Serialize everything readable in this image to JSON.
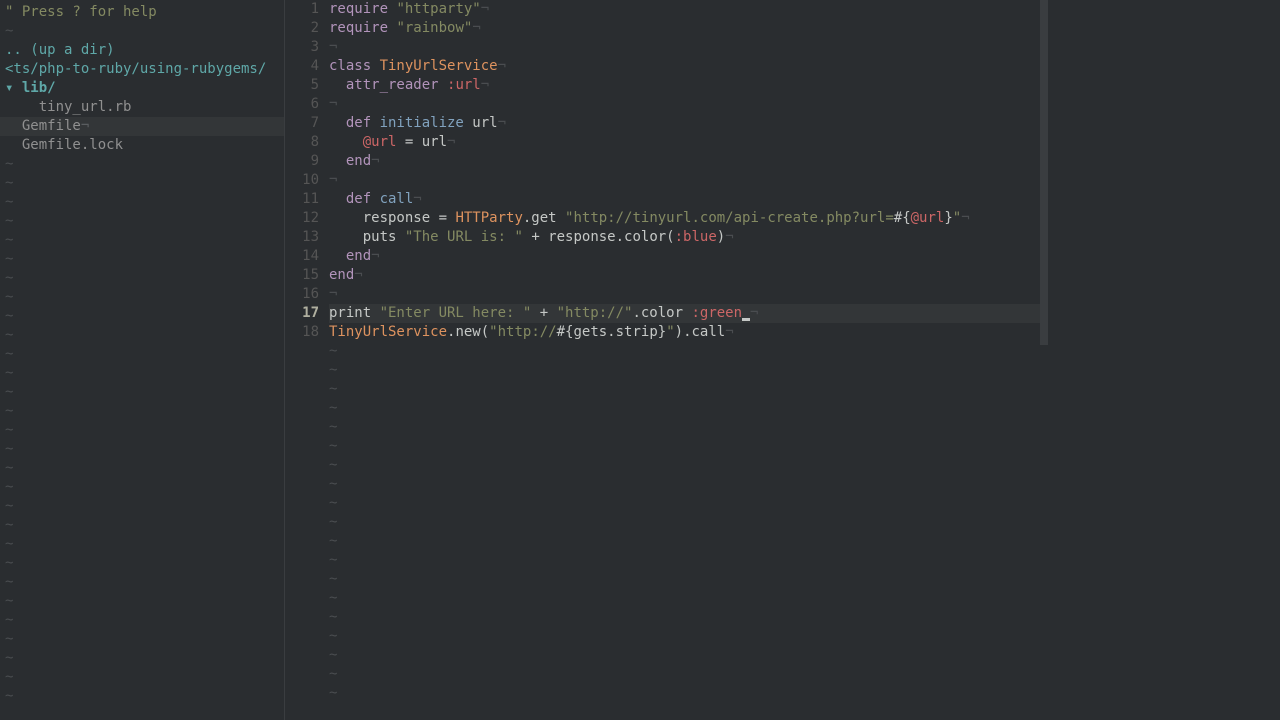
{
  "sidebar": {
    "help": "\" Press ? for help",
    "up_dir": ".. (up a dir)",
    "path": "<ts/php-to-ruby/using-rubygems/",
    "folder": {
      "arrow": "▾",
      "name": "lib/"
    },
    "files": {
      "tiny_url": "tiny_url.rb",
      "gemfile": "Gemfile",
      "gemfile_eol": "¬",
      "gemfile_lock": "Gemfile.lock"
    }
  },
  "gutter": {
    "l1": "1",
    "l2": "2",
    "l3": "3",
    "l4": "4",
    "l5": "5",
    "l6": "6",
    "l7": "7",
    "l8": "8",
    "l9": "9",
    "l10": "10",
    "l11": "11",
    "l12": "12",
    "l13": "13",
    "l14": "14",
    "l15": "15",
    "l16": "16",
    "l17": "17",
    "l18": "18"
  },
  "code": {
    "l1": {
      "kw": "require",
      "str": " \"httparty\"",
      "eol": "¬"
    },
    "l2": {
      "kw": "require",
      "str": " \"rainbow\"",
      "eol": "¬"
    },
    "l3": {
      "eol": "¬"
    },
    "l4": {
      "kw": "class ",
      "cls": "TinyUrlService",
      "eol": "¬"
    },
    "l5": {
      "pad": "  ",
      "kw": "attr_reader ",
      "sym": ":url",
      "eol": "¬"
    },
    "l6": {
      "eol": "¬"
    },
    "l7": {
      "pad": "  ",
      "kw": "def ",
      "fn": "initialize",
      "args": " url",
      "eol": "¬"
    },
    "l8": {
      "pad": "    ",
      "ivar": "@url",
      "rest": " = url",
      "eol": "¬"
    },
    "l9": {
      "pad": "  ",
      "kw": "end",
      "eol": "¬"
    },
    "l10": {
      "eol": "¬"
    },
    "l11": {
      "pad": "  ",
      "kw": "def ",
      "fn": "call",
      "eol": "¬"
    },
    "l12": {
      "pad": "    ",
      "p1": "response = ",
      "cls": "HTTParty",
      "p2": ".get ",
      "s1": "\"http://tinyurl.com/api-create.php?url=",
      "interp_o": "#{",
      "ivar": "@url",
      "interp_c": "}",
      "s2": "\"",
      "eol": "¬"
    },
    "l13": {
      "pad": "    ",
      "p1": "puts ",
      "s1": "\"The URL is: \"",
      "p2": " + response.color(",
      "sym": ":blue",
      "p3": ")",
      "eol": "¬"
    },
    "l14": {
      "pad": "  ",
      "kw": "end",
      "eol": "¬"
    },
    "l15": {
      "kw": "end",
      "eol": "¬"
    },
    "l16": {
      "eol": "¬"
    },
    "l17": {
      "p1": "print ",
      "s1": "\"Enter URL here: \"",
      "p2": " + ",
      "s2": "\"http://\"",
      "p3": ".color ",
      "sym": ":green",
      "eol": "¬"
    },
    "l18": {
      "cls": "TinyUrlService",
      "p1": ".new(",
      "s1": "\"http://",
      "interp_o": "#{",
      "p2": "gets.strip",
      "interp_c": "}",
      "s2": "\"",
      "p3": ").call",
      "eol": "¬"
    }
  },
  "current_line": 17,
  "tilde": "~"
}
